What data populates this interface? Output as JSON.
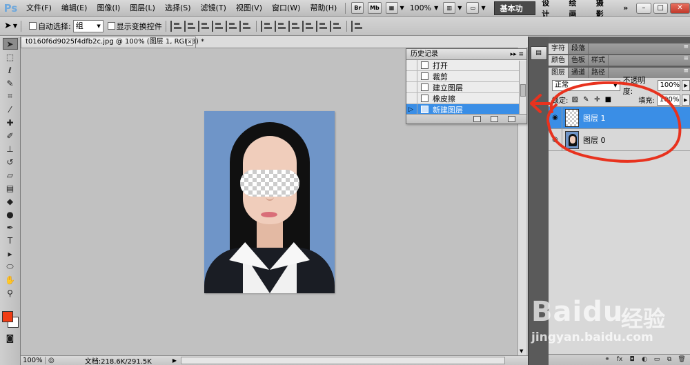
{
  "app": {
    "logo": "Ps"
  },
  "menubar": {
    "items": [
      "文件(F)",
      "编辑(E)",
      "图像(I)",
      "图层(L)",
      "选择(S)",
      "滤镜(T)",
      "视图(V)",
      "窗口(W)",
      "帮助(H)"
    ],
    "bridge_label": "Br",
    "minibridge_label": "Mb",
    "zoom": "100%",
    "workspaces": {
      "active": "基本功能",
      "design": "设计",
      "painting": "绘画",
      "photography": "摄影",
      "more": "»"
    }
  },
  "options": {
    "auto_select_label": "自动选择:",
    "auto_select_value": "组",
    "show_transform_label": "显示变换控件"
  },
  "document": {
    "tab_title": "t0160f6d9025f4dfb2c.jpg @ 100% (图层 1, RGB/8) *",
    "close_label": "×"
  },
  "history": {
    "title": "历史记录",
    "items": [
      {
        "label": "打开"
      },
      {
        "label": "裁剪"
      },
      {
        "label": "建立图层"
      },
      {
        "label": "橡皮擦"
      },
      {
        "label": "新建图层"
      }
    ]
  },
  "panels": {
    "group1_tabs": [
      "字符",
      "段落"
    ],
    "group2_tabs": [
      "颜色",
      "色板",
      "样式"
    ],
    "group3_tabs": [
      "图层",
      "通道",
      "路径"
    ]
  },
  "layers": {
    "blend_mode": "正常",
    "opacity_label": "不透明度:",
    "opacity_value": "100%",
    "lock_label": "锁定:",
    "fill_label": "填充:",
    "fill_value": "100%",
    "items": [
      {
        "name": "图层 1",
        "selected": true
      },
      {
        "name": "图层 0",
        "selected": false
      }
    ]
  },
  "statusbar": {
    "zoom": "100%",
    "doc_info": "文档:218.6K/291.5K"
  },
  "colors": {
    "foreground": "#f03c14",
    "background": "#ffffff",
    "selection": "#3a8ee6",
    "annotation": "#e8321e"
  },
  "watermark": {
    "brand": "Bai",
    "brand2": "du",
    "chinese": "经验",
    "url": "jingyan.baidu.com"
  }
}
